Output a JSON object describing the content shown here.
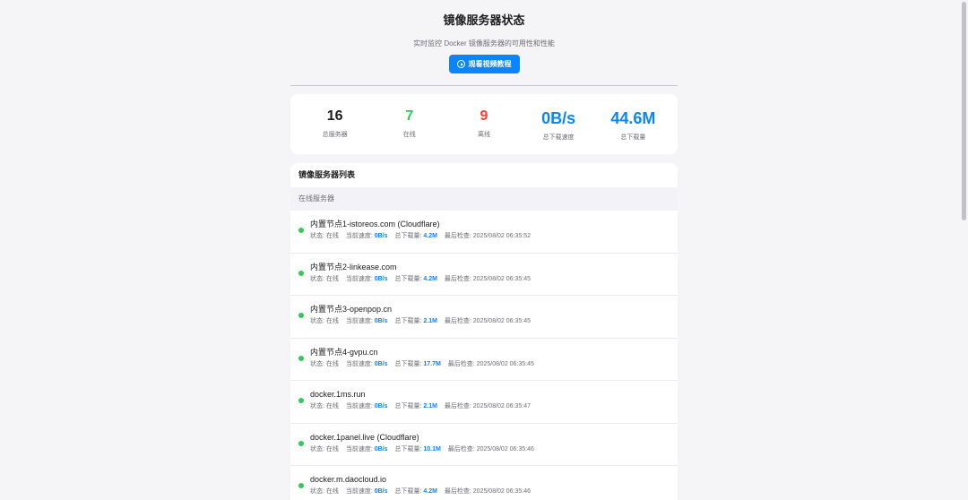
{
  "header": {
    "title": "镜像服务器状态",
    "subtitle": "实时监控 Docker 镜像服务器的可用性和性能",
    "video_button": "观看视频教程"
  },
  "stats": {
    "total": {
      "value": "16",
      "label": "总服务器",
      "color": "#1d1d1f"
    },
    "online": {
      "value": "7",
      "label": "在线",
      "color": "#34c759"
    },
    "offline": {
      "value": "9",
      "label": "离线",
      "color": "#ff3b30"
    },
    "speed": {
      "value": "0B/s",
      "label": "总下载速度",
      "color": "#0a84ff"
    },
    "downloads": {
      "value": "44.6M",
      "label": "总下载量",
      "color": "#0a84ff"
    }
  },
  "list": {
    "title": "镜像服务器列表",
    "group_online": "在线服务器",
    "labels": {
      "status": "状态: ",
      "speed": "当前速度: ",
      "downloads": "总下载量: ",
      "last_check": "最后检查: "
    },
    "items": [
      {
        "name": "内置节点1-istoreos.com (Cloudflare)",
        "status": "在线",
        "speed": "0B/s",
        "downloads": "4.2M",
        "last_check": "2025/08/02 06:35:52"
      },
      {
        "name": "内置节点2-linkease.com",
        "status": "在线",
        "speed": "0B/s",
        "downloads": "4.2M",
        "last_check": "2025/08/02 06:35:45"
      },
      {
        "name": "内置节点3-openpop.cn",
        "status": "在线",
        "speed": "0B/s",
        "downloads": "2.1M",
        "last_check": "2025/08/02 06:35:45"
      },
      {
        "name": "内置节点4-gvpu.cn",
        "status": "在线",
        "speed": "0B/s",
        "downloads": "17.7M",
        "last_check": "2025/08/02 06:35:45"
      },
      {
        "name": "docker.1ms.run",
        "status": "在线",
        "speed": "0B/s",
        "downloads": "2.1M",
        "last_check": "2025/08/02 06:35:47"
      },
      {
        "name": "docker.1panel.live (Cloudflare)",
        "status": "在线",
        "speed": "0B/s",
        "downloads": "10.1M",
        "last_check": "2025/08/02 06:35:46"
      },
      {
        "name": "docker.m.daocloud.io",
        "status": "在线",
        "speed": "0B/s",
        "downloads": "4.2M",
        "last_check": "2025/08/02 06:35:46"
      }
    ]
  }
}
